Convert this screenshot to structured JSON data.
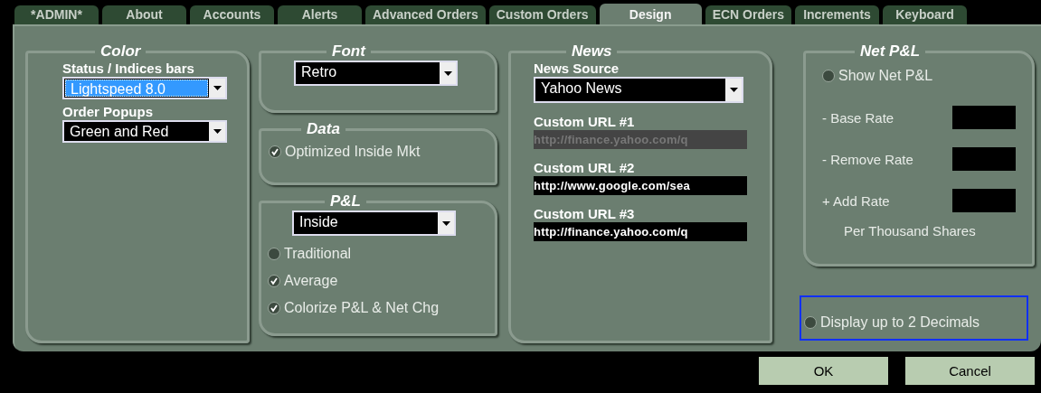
{
  "tabs": [
    {
      "label": "*ADMIN*",
      "selected": false
    },
    {
      "label": "About",
      "selected": false
    },
    {
      "label": "Accounts",
      "selected": false
    },
    {
      "label": "Alerts",
      "selected": false
    },
    {
      "label": "Advanced Orders",
      "selected": false
    },
    {
      "label": "Custom Orders",
      "selected": false
    },
    {
      "label": "Design",
      "selected": true
    },
    {
      "label": "ECN Orders",
      "selected": false
    },
    {
      "label": "Increments",
      "selected": false
    },
    {
      "label": "Keyboard",
      "selected": false
    }
  ],
  "color": {
    "title": "Color",
    "fields": [
      {
        "label": "Status / Indices bars",
        "value": "Lightspeed 8.0",
        "focused": true
      },
      {
        "label": "Order Popups",
        "value": "Green and Red",
        "focused": false
      }
    ]
  },
  "font": {
    "title": "Font",
    "value": "Retro"
  },
  "data": {
    "title": "Data",
    "options": [
      {
        "label": "Optimized Inside Mkt",
        "checked": true
      }
    ]
  },
  "pnl": {
    "title": "P&L",
    "value": "Inside",
    "options": [
      {
        "label": "Traditional",
        "checked": false
      },
      {
        "label": "Average",
        "checked": true
      },
      {
        "label": "Colorize P&L & Net Chg",
        "checked": true
      }
    ]
  },
  "news": {
    "title": "News",
    "source_label": "News Source",
    "source": "Yahoo News",
    "urls": [
      {
        "label": "Custom URL #1",
        "value": "http://finance.yahoo.com/q",
        "disabled": true
      },
      {
        "label": "Custom URL #2",
        "value": "http://www.google.com/sea",
        "disabled": false
      },
      {
        "label": "Custom URL #3",
        "value": "http://finance.yahoo.com/q",
        "disabled": false
      }
    ]
  },
  "net_pnl": {
    "title": "Net P&L",
    "show": {
      "label": "Show Net P&L",
      "checked": false
    },
    "rates": [
      {
        "label": "- Base Rate"
      },
      {
        "label": "- Remove Rate"
      },
      {
        "label": "+ Add Rate"
      }
    ],
    "note": "Per Thousand Shares"
  },
  "decimals": {
    "label": "Display up to 2 Decimals",
    "checked": false,
    "focused": true
  },
  "buttons": [
    {
      "label": "OK"
    },
    {
      "label": "Cancel"
    }
  ]
}
